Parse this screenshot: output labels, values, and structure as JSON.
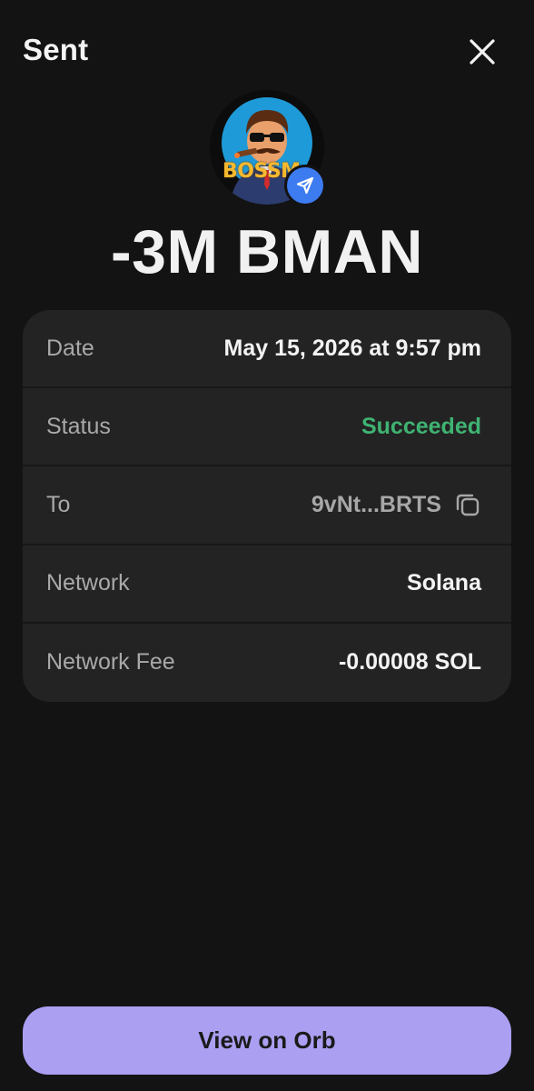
{
  "header": {
    "title": "Sent"
  },
  "token": {
    "icon": "bossman-mascot-avatar",
    "logo_text": "BOSSM",
    "badge_icon": "send-arrow-icon"
  },
  "amount": "-3M BMAN",
  "details": {
    "date": {
      "label": "Date",
      "value": "May 15, 2026 at 9:57 pm"
    },
    "status": {
      "label": "Status",
      "value": "Succeeded",
      "color": "#3fb372"
    },
    "to": {
      "label": "To",
      "value": "9vNt...BRTS"
    },
    "network": {
      "label": "Network",
      "value": "Solana"
    },
    "fee": {
      "label": "Network Fee",
      "value": "-0.00008 SOL"
    }
  },
  "actions": {
    "view_label": "View on Orb"
  },
  "colors": {
    "background": "#131313",
    "card": "#232323",
    "accent": "#ab9ff2",
    "badge": "#3d7bf0"
  }
}
